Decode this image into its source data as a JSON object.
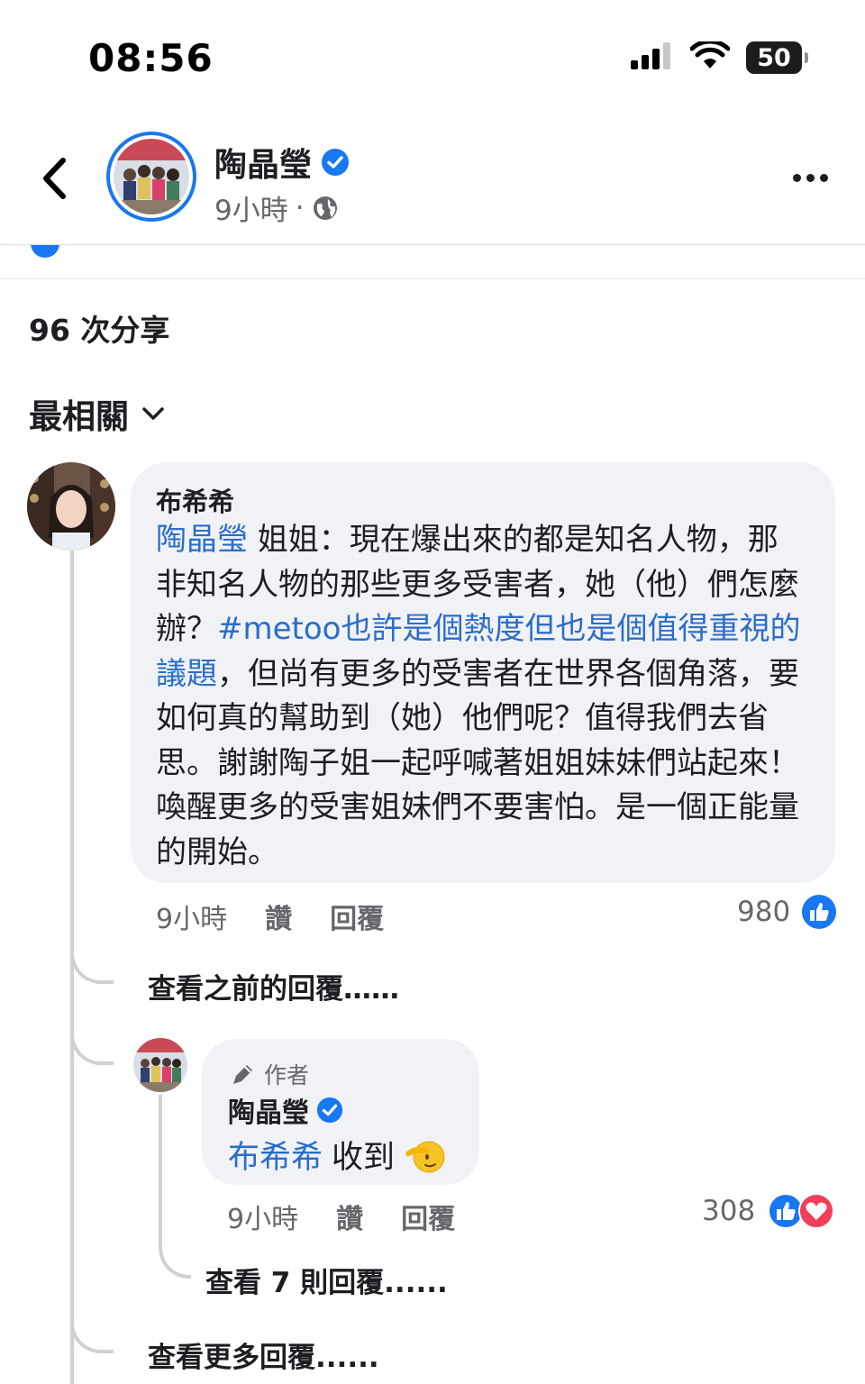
{
  "status_bar": {
    "time": "08:56",
    "battery_level": "50"
  },
  "header": {
    "name": "陶晶瑩",
    "time_ago": "9小時",
    "separator": "·"
  },
  "post": {
    "shares_count": "96 次分享"
  },
  "sort": {
    "label": "最相關"
  },
  "comment": {
    "author": "布希希",
    "mention": "陶晶瑩",
    "text_part1": " 姐姐：現在爆出來的都是知名人物，那非知名人物的那些更多受害者，她（他）們怎麼辦？",
    "hashtag": "#metoo也許是個熱度但也是個值得重視的議題",
    "text_part2": "，但尚有更多的受害者在世界各個角落，要如何真的幫助到（她）他們呢？值得我們去省思。謝謝陶子姐一起呼喊著姐姐妹妹們站起來！喚醒更多的受害姐妹們不要害怕。是一個正能量的開始。",
    "time": "9小時",
    "like_label": "讚",
    "reply_label": "回覆",
    "reaction_count": "980"
  },
  "view_previous_replies": "查看之前的回覆……",
  "reply": {
    "badge": "作者",
    "author": "陶晶瑩",
    "mention": "布希希",
    "text": "收到",
    "time": "9小時",
    "like_label": "讚",
    "reply_label": "回覆",
    "reaction_count": "308"
  },
  "view_seven_replies": "查看 7 則回覆......",
  "view_more_replies": "查看更多回覆......",
  "colors": {
    "accent": "#1877f2",
    "mention": "#2a6dcc",
    "bubble": "#f0f2f5",
    "love": "#f33e58"
  }
}
